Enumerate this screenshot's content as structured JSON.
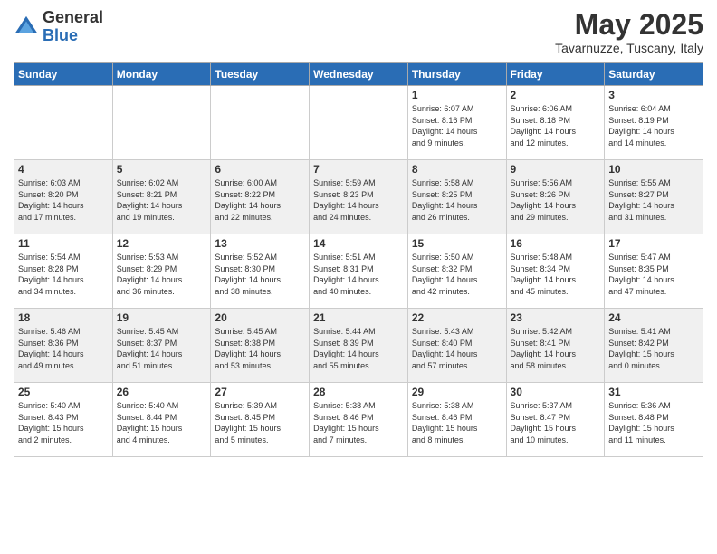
{
  "header": {
    "logo_general": "General",
    "logo_blue": "Blue",
    "month_title": "May 2025",
    "location": "Tavarnuzze, Tuscany, Italy"
  },
  "weekdays": [
    "Sunday",
    "Monday",
    "Tuesday",
    "Wednesday",
    "Thursday",
    "Friday",
    "Saturday"
  ],
  "weeks": [
    [
      {
        "day": "",
        "info": ""
      },
      {
        "day": "",
        "info": ""
      },
      {
        "day": "",
        "info": ""
      },
      {
        "day": "",
        "info": ""
      },
      {
        "day": "1",
        "info": "Sunrise: 6:07 AM\nSunset: 8:16 PM\nDaylight: 14 hours\nand 9 minutes."
      },
      {
        "day": "2",
        "info": "Sunrise: 6:06 AM\nSunset: 8:18 PM\nDaylight: 14 hours\nand 12 minutes."
      },
      {
        "day": "3",
        "info": "Sunrise: 6:04 AM\nSunset: 8:19 PM\nDaylight: 14 hours\nand 14 minutes."
      }
    ],
    [
      {
        "day": "4",
        "info": "Sunrise: 6:03 AM\nSunset: 8:20 PM\nDaylight: 14 hours\nand 17 minutes."
      },
      {
        "day": "5",
        "info": "Sunrise: 6:02 AM\nSunset: 8:21 PM\nDaylight: 14 hours\nand 19 minutes."
      },
      {
        "day": "6",
        "info": "Sunrise: 6:00 AM\nSunset: 8:22 PM\nDaylight: 14 hours\nand 22 minutes."
      },
      {
        "day": "7",
        "info": "Sunrise: 5:59 AM\nSunset: 8:23 PM\nDaylight: 14 hours\nand 24 minutes."
      },
      {
        "day": "8",
        "info": "Sunrise: 5:58 AM\nSunset: 8:25 PM\nDaylight: 14 hours\nand 26 minutes."
      },
      {
        "day": "9",
        "info": "Sunrise: 5:56 AM\nSunset: 8:26 PM\nDaylight: 14 hours\nand 29 minutes."
      },
      {
        "day": "10",
        "info": "Sunrise: 5:55 AM\nSunset: 8:27 PM\nDaylight: 14 hours\nand 31 minutes."
      }
    ],
    [
      {
        "day": "11",
        "info": "Sunrise: 5:54 AM\nSunset: 8:28 PM\nDaylight: 14 hours\nand 34 minutes."
      },
      {
        "day": "12",
        "info": "Sunrise: 5:53 AM\nSunset: 8:29 PM\nDaylight: 14 hours\nand 36 minutes."
      },
      {
        "day": "13",
        "info": "Sunrise: 5:52 AM\nSunset: 8:30 PM\nDaylight: 14 hours\nand 38 minutes."
      },
      {
        "day": "14",
        "info": "Sunrise: 5:51 AM\nSunset: 8:31 PM\nDaylight: 14 hours\nand 40 minutes."
      },
      {
        "day": "15",
        "info": "Sunrise: 5:50 AM\nSunset: 8:32 PM\nDaylight: 14 hours\nand 42 minutes."
      },
      {
        "day": "16",
        "info": "Sunrise: 5:48 AM\nSunset: 8:34 PM\nDaylight: 14 hours\nand 45 minutes."
      },
      {
        "day": "17",
        "info": "Sunrise: 5:47 AM\nSunset: 8:35 PM\nDaylight: 14 hours\nand 47 minutes."
      }
    ],
    [
      {
        "day": "18",
        "info": "Sunrise: 5:46 AM\nSunset: 8:36 PM\nDaylight: 14 hours\nand 49 minutes."
      },
      {
        "day": "19",
        "info": "Sunrise: 5:45 AM\nSunset: 8:37 PM\nDaylight: 14 hours\nand 51 minutes."
      },
      {
        "day": "20",
        "info": "Sunrise: 5:45 AM\nSunset: 8:38 PM\nDaylight: 14 hours\nand 53 minutes."
      },
      {
        "day": "21",
        "info": "Sunrise: 5:44 AM\nSunset: 8:39 PM\nDaylight: 14 hours\nand 55 minutes."
      },
      {
        "day": "22",
        "info": "Sunrise: 5:43 AM\nSunset: 8:40 PM\nDaylight: 14 hours\nand 57 minutes."
      },
      {
        "day": "23",
        "info": "Sunrise: 5:42 AM\nSunset: 8:41 PM\nDaylight: 14 hours\nand 58 minutes."
      },
      {
        "day": "24",
        "info": "Sunrise: 5:41 AM\nSunset: 8:42 PM\nDaylight: 15 hours\nand 0 minutes."
      }
    ],
    [
      {
        "day": "25",
        "info": "Sunrise: 5:40 AM\nSunset: 8:43 PM\nDaylight: 15 hours\nand 2 minutes."
      },
      {
        "day": "26",
        "info": "Sunrise: 5:40 AM\nSunset: 8:44 PM\nDaylight: 15 hours\nand 4 minutes."
      },
      {
        "day": "27",
        "info": "Sunrise: 5:39 AM\nSunset: 8:45 PM\nDaylight: 15 hours\nand 5 minutes."
      },
      {
        "day": "28",
        "info": "Sunrise: 5:38 AM\nSunset: 8:46 PM\nDaylight: 15 hours\nand 7 minutes."
      },
      {
        "day": "29",
        "info": "Sunrise: 5:38 AM\nSunset: 8:46 PM\nDaylight: 15 hours\nand 8 minutes."
      },
      {
        "day": "30",
        "info": "Sunrise: 5:37 AM\nSunset: 8:47 PM\nDaylight: 15 hours\nand 10 minutes."
      },
      {
        "day": "31",
        "info": "Sunrise: 5:36 AM\nSunset: 8:48 PM\nDaylight: 15 hours\nand 11 minutes."
      }
    ]
  ]
}
